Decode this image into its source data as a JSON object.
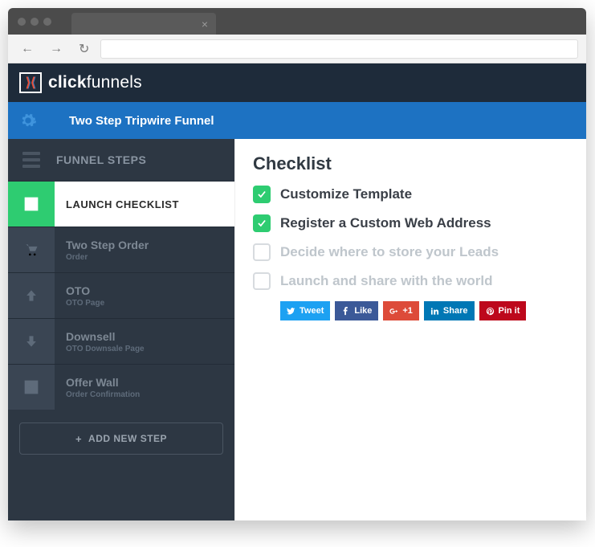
{
  "brand": {
    "part1": "click",
    "part2": "funnels"
  },
  "funnel_title": "Two Step Tripwire Funnel",
  "sidebar": {
    "header": "FUNNEL STEPS",
    "items": [
      {
        "label": "LAUNCH CHECKLIST",
        "sub": ""
      },
      {
        "label": "Two Step Order",
        "sub": "Order"
      },
      {
        "label": "OTO",
        "sub": "OTO Page"
      },
      {
        "label": "Downsell",
        "sub": "OTO Downsale Page"
      },
      {
        "label": "Offer Wall",
        "sub": "Order Confirmation"
      }
    ],
    "add_label": "ADD NEW STEP"
  },
  "main": {
    "title": "Checklist",
    "items": [
      {
        "label": "Customize Template"
      },
      {
        "label": "Register a Custom Web Address"
      },
      {
        "label": "Decide where to store your Leads"
      },
      {
        "label": "Launch and share with the world"
      }
    ]
  },
  "share": {
    "tweet": "Tweet",
    "like": "Like",
    "plus": "+1",
    "share": "Share",
    "pin": "Pin it"
  }
}
